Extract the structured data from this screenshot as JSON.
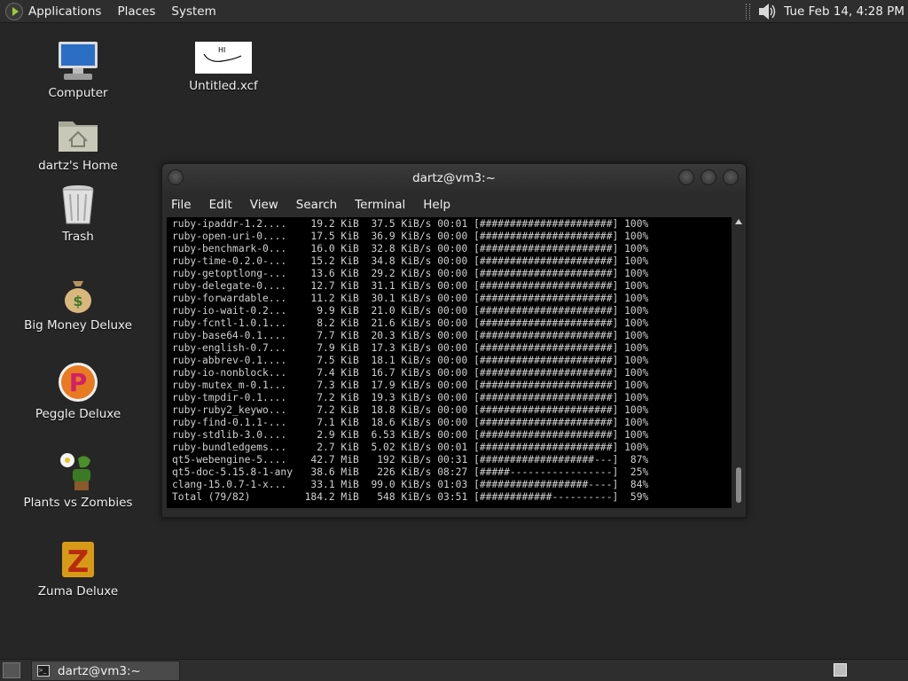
{
  "top_panel": {
    "menus": [
      "Applications",
      "Places",
      "System"
    ],
    "clock": "Tue Feb 14,  4:28 PM"
  },
  "desktop": {
    "icons": [
      {
        "label": "Computer",
        "icon": "computer-icon"
      },
      {
        "label": "dartz's Home",
        "icon": "home-folder-icon"
      },
      {
        "label": "Trash",
        "icon": "trash-icon"
      },
      {
        "label": "Big Money Deluxe",
        "icon": "money-bag-icon"
      },
      {
        "label": "Peggle Deluxe",
        "icon": "peggle-icon"
      },
      {
        "label": "Plants vs Zombies",
        "icon": "plants-vs-zombies-icon"
      },
      {
        "label": "Zuma Deluxe",
        "icon": "zuma-icon"
      },
      {
        "label": "Untitled.xcf",
        "icon": "image-file-icon",
        "thumbnail_text": "HI"
      }
    ]
  },
  "terminal": {
    "title": "dartz@vm3:~",
    "menu": [
      "File",
      "Edit",
      "View",
      "Search",
      "Terminal",
      "Help"
    ],
    "lines": [
      "ruby-ipaddr-1.2....    19.2 KiB  37.5 KiB/s 00:01 [######################] 100%",
      "ruby-open-uri-0....    17.5 KiB  36.9 KiB/s 00:00 [######################] 100%",
      "ruby-benchmark-0...    16.0 KiB  32.8 KiB/s 00:00 [######################] 100%",
      "ruby-time-0.2.0-...    15.2 KiB  34.8 KiB/s 00:00 [######################] 100%",
      "ruby-getoptlong-...    13.6 KiB  29.2 KiB/s 00:00 [######################] 100%",
      "ruby-delegate-0....    12.7 KiB  31.1 KiB/s 00:00 [######################] 100%",
      "ruby-forwardable...    11.2 KiB  30.1 KiB/s 00:00 [######################] 100%",
      "ruby-io-wait-0.2...     9.9 KiB  21.0 KiB/s 00:00 [######################] 100%",
      "ruby-fcntl-1.0.1...     8.2 KiB  21.6 KiB/s 00:00 [######################] 100%",
      "ruby-base64-0.1....     7.7 KiB  20.3 KiB/s 00:00 [######################] 100%",
      "ruby-english-0.7...     7.9 KiB  17.3 KiB/s 00:00 [######################] 100%",
      "ruby-abbrev-0.1....     7.5 KiB  18.1 KiB/s 00:00 [######################] 100%",
      "ruby-io-nonblock...     7.4 KiB  16.7 KiB/s 00:00 [######################] 100%",
      "ruby-mutex_m-0.1...     7.3 KiB  17.9 KiB/s 00:00 [######################] 100%",
      "ruby-tmpdir-0.1....     7.2 KiB  19.3 KiB/s 00:00 [######################] 100%",
      "ruby-ruby2_keywo...     7.2 KiB  18.8 KiB/s 00:00 [######################] 100%",
      "ruby-find-0.1.1-...     7.1 KiB  18.6 KiB/s 00:00 [######################] 100%",
      "ruby-stdlib-3.0....     2.9 KiB  6.53 KiB/s 00:00 [######################] 100%",
      "ruby-bundledgems...     2.7 KiB  5.02 KiB/s 00:01 [######################] 100%",
      "qt5-webengine-5....    42.7 MiB   192 KiB/s 00:31 [###################---]  87%",
      "qt5-doc-5.15.8-1-any   38.6 MiB   226 KiB/s 08:27 [#####-----------------]  25%",
      "clang-15.0.7-1-x...    33.1 MiB  99.0 KiB/s 01:03 [##################----]  84%",
      "Total (79/82)         184.2 MiB   548 KiB/s 03:51 [############----------]  59%"
    ]
  },
  "taskbar": {
    "items": [
      {
        "label": "dartz@vm3:~"
      }
    ]
  }
}
